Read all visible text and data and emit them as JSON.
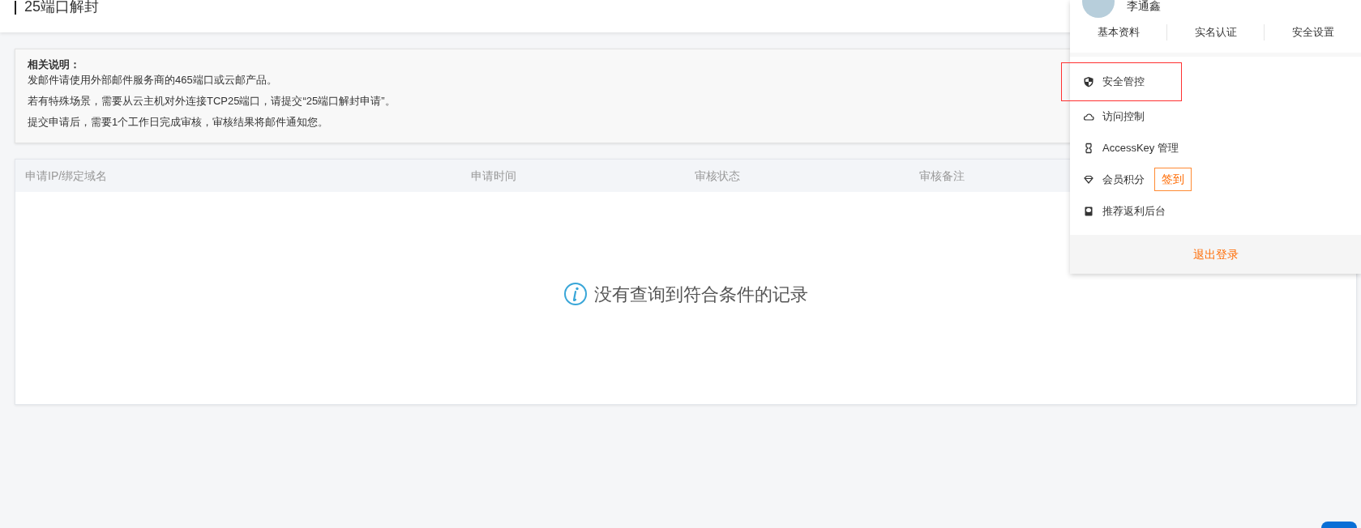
{
  "page_title": "25端口解封",
  "notice": {
    "heading": "相关说明：",
    "lines": [
      "发邮件请使用外部邮件服务商的465端口或云邮产品。",
      "若有特殊场景，需要从云主机对外连接TCP25端口，请提交“25端口解封申请”。",
      "提交申请后，需要1个工作日完成审核，审核结果将邮件通知您。"
    ]
  },
  "table": {
    "columns": [
      "申请IP/绑定域名",
      "申请时间",
      "审核状态",
      "审核备注"
    ],
    "empty_message": "没有查询到符合条件的记录"
  },
  "user_menu": {
    "username": "李通鑫",
    "tabs": [
      "基本资料",
      "实名认证",
      "安全设置"
    ],
    "items": [
      {
        "kind": "shield",
        "label": "安全管控",
        "highlighted": true
      },
      {
        "kind": "cloud",
        "label": "访问控制",
        "highlighted": false
      },
      {
        "kind": "key",
        "label": "AccessKey 管理",
        "highlighted": false
      },
      {
        "kind": "diamond",
        "label": "会员积分",
        "highlighted": false,
        "badge": "签到"
      },
      {
        "kind": "book",
        "label": "推荐返利后台",
        "highlighted": false
      }
    ],
    "logout": "退出登录"
  }
}
